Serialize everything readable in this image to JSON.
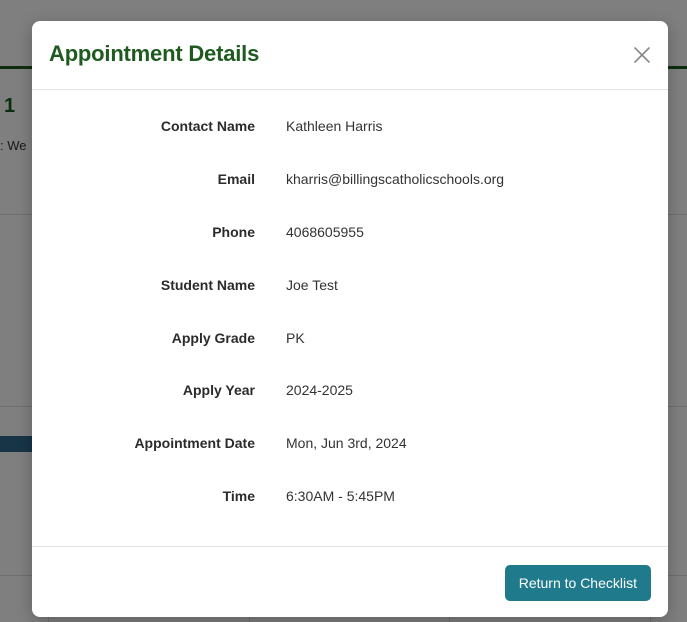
{
  "background": {
    "heading_fragment": "1",
    "subtext_fragment": ": We"
  },
  "modal": {
    "title": "Appointment Details",
    "close_icon": "close-icon",
    "details": [
      {
        "label": "Contact Name",
        "value": "Kathleen Harris"
      },
      {
        "label": "Email",
        "value": "kharris@billingscatholicschools.org"
      },
      {
        "label": "Phone",
        "value": "4068605955"
      },
      {
        "label": "Student Name",
        "value": "Joe Test"
      },
      {
        "label": "Apply Grade",
        "value": "PK"
      },
      {
        "label": "Apply Year",
        "value": "2024-2025"
      },
      {
        "label": "Appointment Date",
        "value": "Mon, Jun 3rd, 2024"
      },
      {
        "label": "Time",
        "value": "6:30AM - 5:45PM"
      }
    ],
    "footer": {
      "return_label": "Return to Checklist"
    }
  },
  "colors": {
    "title_green": "#1f5b1f",
    "button_teal": "#1f7a8c",
    "topbar_green": "#1a5d1a"
  }
}
